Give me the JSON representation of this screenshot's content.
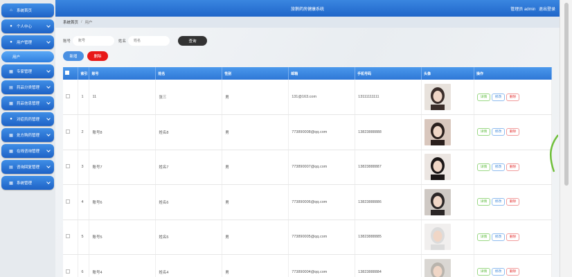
{
  "header": {
    "title": "旅鹅药房健康系统",
    "user_role": "管理员 admin",
    "logout": "退出登录"
  },
  "sidebar": {
    "items": [
      {
        "label": "系统首页",
        "icon": "home-icon"
      },
      {
        "label": "个人中心",
        "icon": "user-icon"
      },
      {
        "label": "用户管理",
        "icon": "user-icon",
        "sub": "用户"
      },
      {
        "label": "专家管理",
        "icon": "grid-icon"
      },
      {
        "label": "药品分类管理",
        "icon": "table-icon"
      },
      {
        "label": "药品信息管理",
        "icon": "grid-icon"
      },
      {
        "label": "对症药药管理",
        "icon": "user-icon"
      },
      {
        "label": "处方购药管理",
        "icon": "grid-icon"
      },
      {
        "label": "在线咨询管理",
        "icon": "grid-icon"
      },
      {
        "label": "咨询回复管理",
        "icon": "table-icon"
      },
      {
        "label": "系统管理",
        "icon": "grid-icon"
      }
    ]
  },
  "breadcrumb": {
    "home": "系统首页",
    "current": "用户"
  },
  "search": {
    "account_label": "账号",
    "account_placeholder": "账号",
    "name_label": "姓名",
    "name_placeholder": "姓名",
    "query_button": "查询"
  },
  "actions": {
    "add": "新增",
    "delete": "删除"
  },
  "table": {
    "headers": [
      "索引",
      "账号",
      "姓名",
      "性别",
      "邮箱",
      "手机号码",
      "头像",
      "操作"
    ],
    "op_labels": {
      "detail": "详情",
      "edit": "修改",
      "delete": "删除"
    },
    "rows": [
      {
        "index": "1",
        "account": "11",
        "name": "张三",
        "gender": "男",
        "email": "131@163.com",
        "phone": "13111111111"
      },
      {
        "index": "2",
        "account": "账号8",
        "name": "姓名8",
        "gender": "男",
        "email": "773890008@qq.com",
        "phone": "13823888888"
      },
      {
        "index": "3",
        "account": "账号7",
        "name": "姓名7",
        "gender": "男",
        "email": "773890007@qq.com",
        "phone": "13823888887"
      },
      {
        "index": "4",
        "account": "账号6",
        "name": "姓名6",
        "gender": "男",
        "email": "773890006@qq.com",
        "phone": "13823888886"
      },
      {
        "index": "5",
        "account": "账号5",
        "name": "姓名5",
        "gender": "男",
        "email": "773890005@qq.com",
        "phone": "13823888885"
      },
      {
        "index": "6",
        "account": "账号4",
        "name": "姓名4",
        "gender": "男",
        "email": "773890004@qq.com",
        "phone": "13823888884"
      }
    ]
  },
  "colors": {
    "primary": "#1f66c9",
    "danger": "#e81818",
    "query": "#333333"
  }
}
